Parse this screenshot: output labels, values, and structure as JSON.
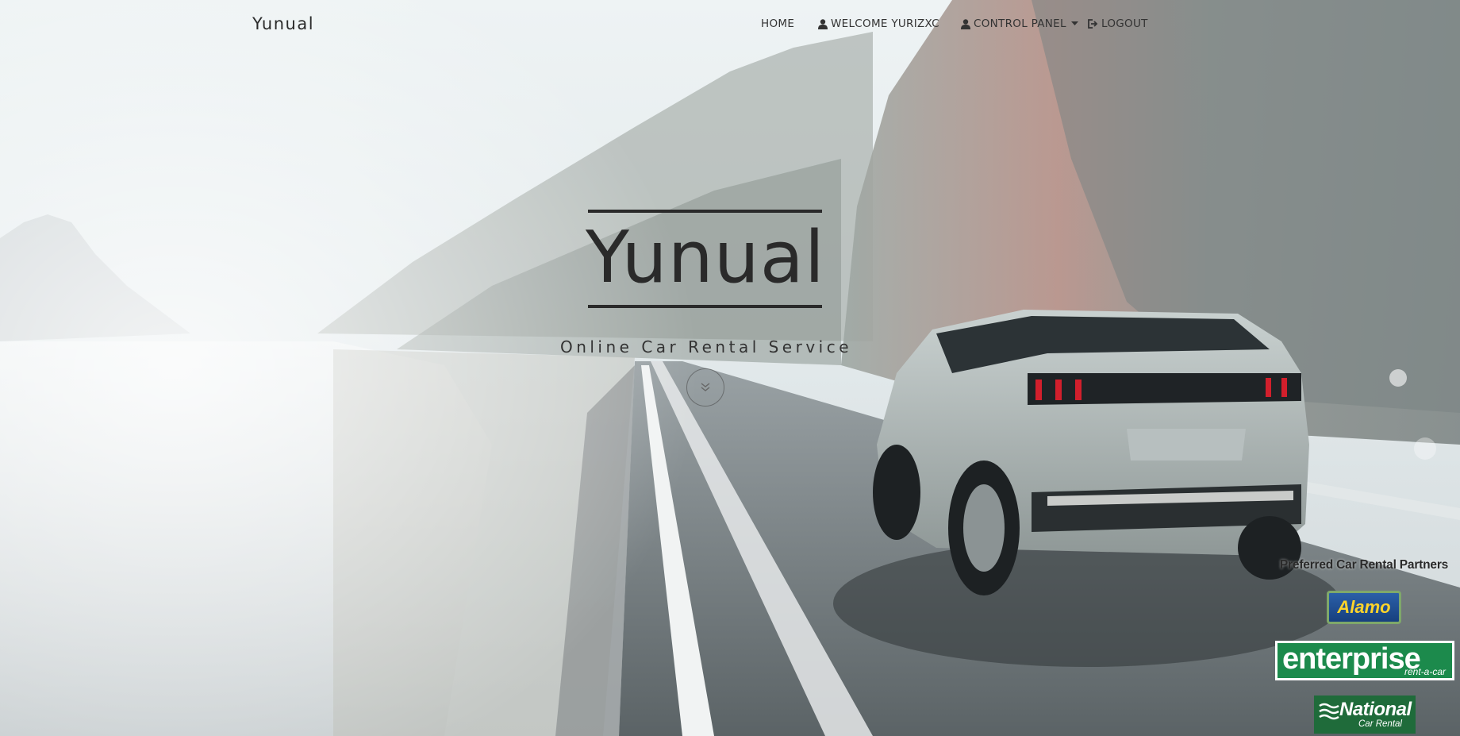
{
  "brand": "Yunual",
  "nav": {
    "home": "HOME",
    "welcome": "WELCOME YURIZXC",
    "control_panel": "CONTROL PANEL",
    "logout": "LOGOUT"
  },
  "hero": {
    "title": "Yunual",
    "subtitle": "Online Car Rental Service"
  },
  "partners": {
    "title": "Preferred Car Rental Partners",
    "alamo": "Alamo",
    "enterprise": "enterprise",
    "enterprise_tagline": "rent-a-car",
    "national": "National",
    "national_tagline": "Car Rental"
  },
  "colors": {
    "text_dark": "#2a2a2a",
    "enterprise_green": "#1c8a4c",
    "national_green": "#1f6b3a",
    "alamo_blue": "#2b5fa8",
    "alamo_yellow": "#ffd42a"
  }
}
